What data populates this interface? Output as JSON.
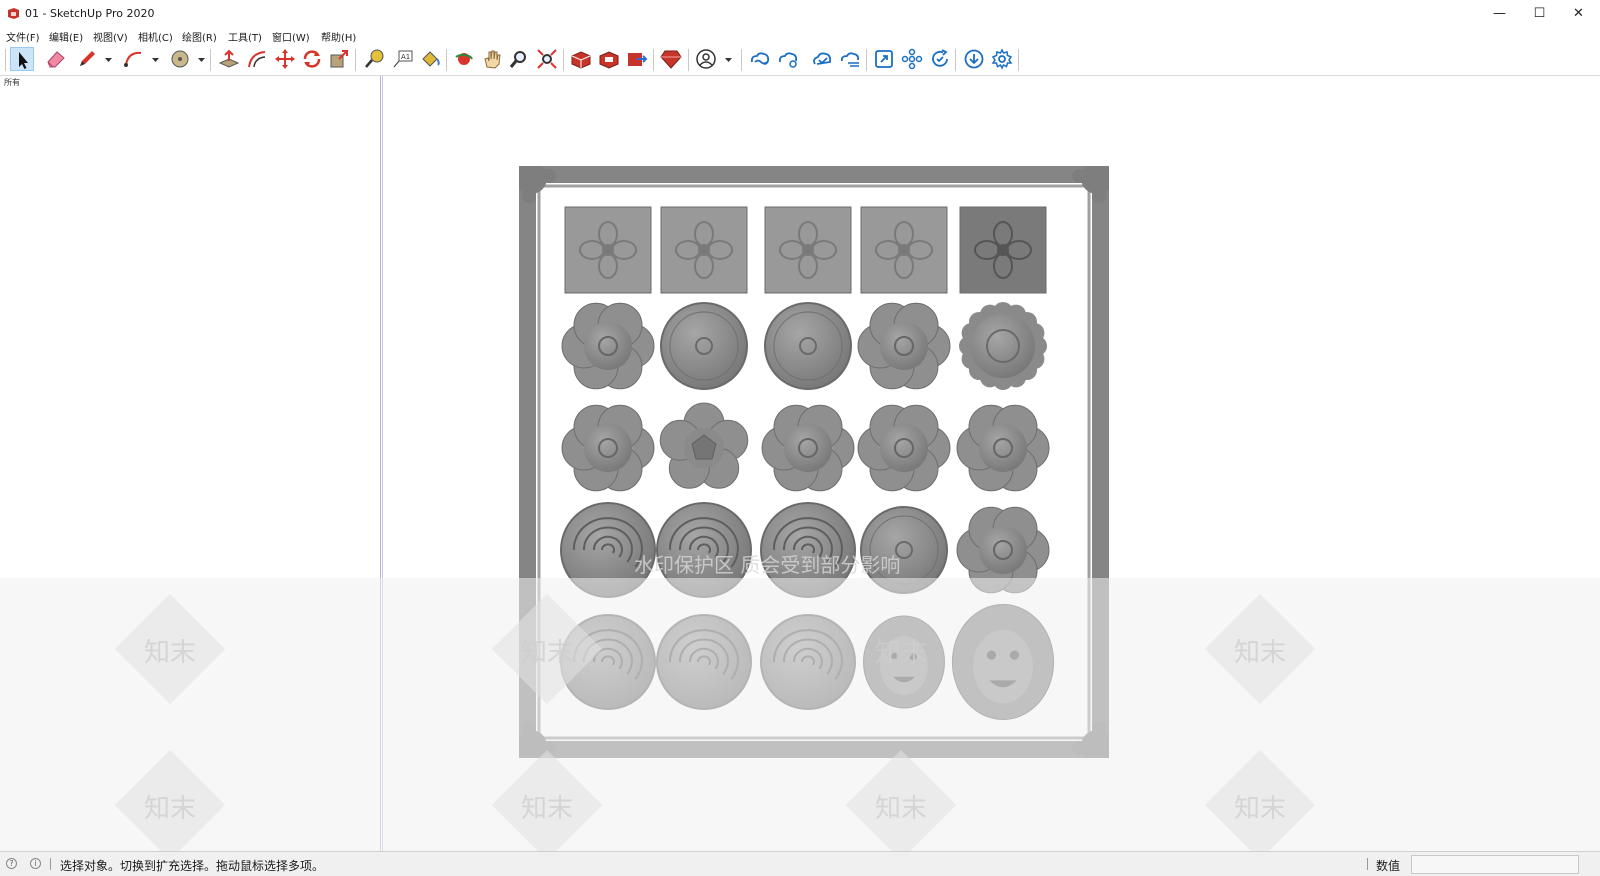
{
  "window": {
    "title": "01 - SketchUp Pro 2020",
    "minimize_glyph": "—",
    "maximize_glyph": "☐",
    "close_glyph": "✕"
  },
  "menu": {
    "items": [
      {
        "label": "文件(F)"
      },
      {
        "label": "编辑(E)"
      },
      {
        "label": "视图(V)"
      },
      {
        "label": "相机(C)"
      },
      {
        "label": "绘图(R)"
      },
      {
        "label": "工具(T)"
      },
      {
        "label": "窗口(W)"
      },
      {
        "label": "帮助(H)"
      }
    ]
  },
  "toolbar": {
    "tools": [
      {
        "name": "select",
        "icon": "arrow-cursor-icon",
        "active": true
      },
      {
        "name": "eraser",
        "icon": "eraser-icon"
      },
      {
        "name": "line",
        "icon": "pencil-icon"
      },
      {
        "name": "arc",
        "icon": "arc-icon"
      },
      {
        "name": "shapes",
        "icon": "circle-icon"
      },
      {
        "name": "push-pull",
        "icon": "push-pull-icon"
      },
      {
        "name": "offset",
        "icon": "offset-icon"
      },
      {
        "name": "move",
        "icon": "move-icon"
      },
      {
        "name": "rotate",
        "icon": "rotate-icon"
      },
      {
        "name": "scale",
        "icon": "scale-icon"
      },
      {
        "name": "tape-measure",
        "icon": "tape-measure-icon"
      },
      {
        "name": "text",
        "icon": "text-icon"
      },
      {
        "name": "paint-bucket",
        "icon": "paint-bucket-icon"
      },
      {
        "name": "orbit",
        "icon": "orbit-icon"
      },
      {
        "name": "pan",
        "icon": "pan-hand-icon"
      },
      {
        "name": "zoom",
        "icon": "zoom-icon"
      },
      {
        "name": "zoom-extents",
        "icon": "zoom-extents-icon"
      },
      {
        "name": "warehouse",
        "icon": "3d-warehouse-icon"
      },
      {
        "name": "extension-warehouse",
        "icon": "extension-warehouse-icon"
      },
      {
        "name": "send-to-layout",
        "icon": "layout-icon"
      },
      {
        "name": "extension-manager",
        "icon": "ruby-icon"
      },
      {
        "name": "account",
        "icon": "user-icon"
      },
      {
        "name": "cloud-1",
        "icon": "cloud-link-icon"
      },
      {
        "name": "cloud-2",
        "icon": "cloud-share-icon"
      },
      {
        "name": "cloud-3",
        "icon": "cloud-check-icon"
      },
      {
        "name": "cloud-4",
        "icon": "cloud-lines-icon"
      },
      {
        "name": "fit",
        "icon": "resize-icon"
      },
      {
        "name": "flower-settings",
        "icon": "flower-icon"
      },
      {
        "name": "refresh-check",
        "icon": "refresh-check-icon"
      },
      {
        "name": "download",
        "icon": "download-circle-icon"
      },
      {
        "name": "settings",
        "icon": "gear-icon"
      }
    ],
    "accent": "#1a6fc4"
  },
  "panel": {
    "label": "所有"
  },
  "watermark": {
    "logo_text": "知末",
    "line": "水印保护区  质会受到部分影响"
  },
  "status": {
    "message": "选择对象。切换到扩充选择。拖动鼠标选择多项。",
    "measure_label": "数值",
    "measure_value": ""
  },
  "model": {
    "rows": [
      [
        "square-tile",
        "square-tile",
        "square-tile",
        "square-tile",
        "square-tile-dark"
      ],
      [
        "flower",
        "round-medallion",
        "round-medallion",
        "flower",
        "sunflower"
      ],
      [
        "flower",
        "five-petal-star",
        "flower",
        "flower",
        "flower"
      ],
      [
        "rose",
        "rose",
        "rose",
        "round-medallion",
        "flower"
      ],
      [
        "rose",
        "rose",
        "rose",
        "lion-small",
        "lion-head"
      ]
    ],
    "colors": {
      "ornament": "#8e8e8e",
      "ornament_dark": "#6d6d6d",
      "frame": "#858585"
    }
  }
}
